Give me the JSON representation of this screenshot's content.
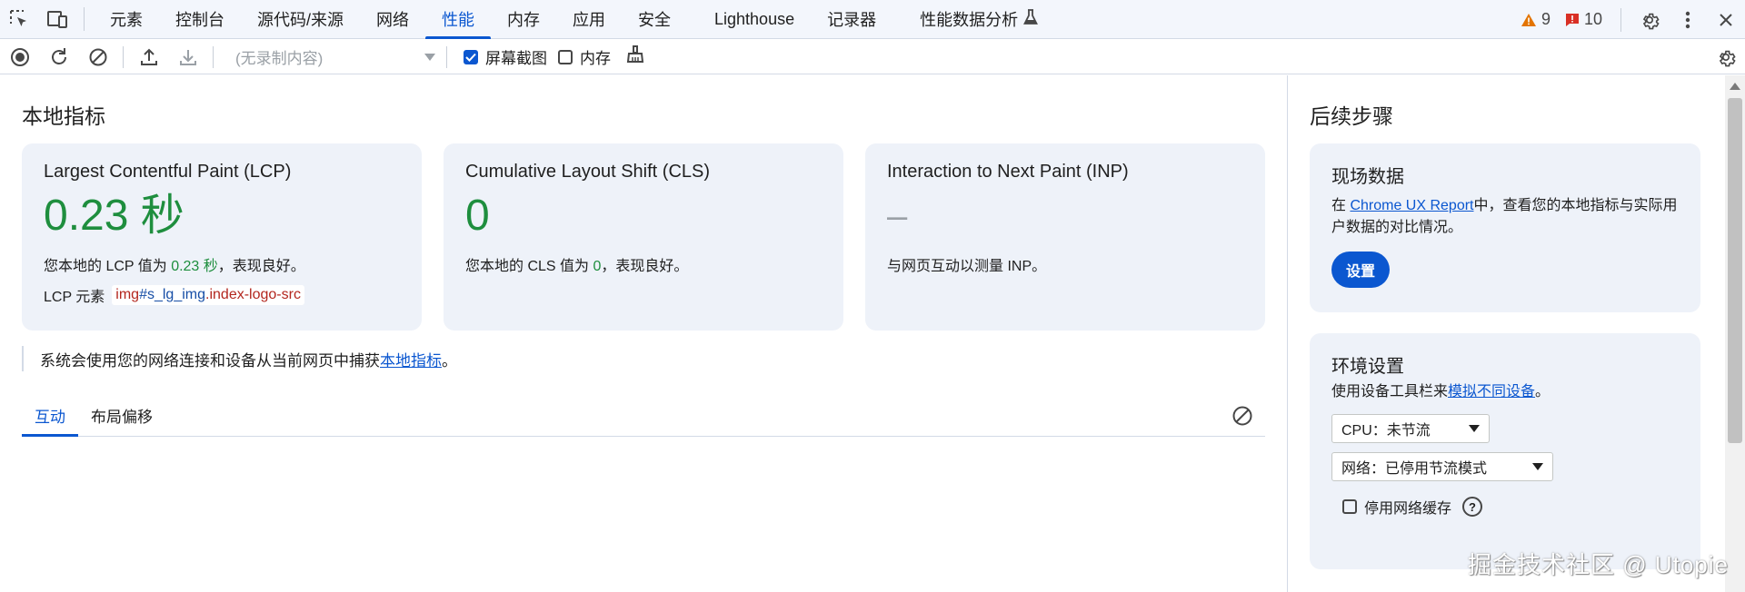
{
  "topbar": {
    "tabs": [
      {
        "label": "元素"
      },
      {
        "label": "控制台"
      },
      {
        "label": "源代码/来源"
      },
      {
        "label": "网络"
      },
      {
        "label": "性能"
      },
      {
        "label": "内存"
      },
      {
        "label": "应用"
      },
      {
        "label": "安全"
      },
      {
        "label": "Lighthouse"
      },
      {
        "label": "记录器"
      },
      {
        "label": "性能数据分析"
      }
    ],
    "active_tab": "性能",
    "warnings_count": "9",
    "issues_count": "10"
  },
  "toolbar": {
    "recording_placeholder": "(无录制内容)",
    "screenshots_label": "屏幕截图",
    "screenshots_checked": true,
    "memory_label": "内存",
    "memory_checked": false
  },
  "main": {
    "title": "本地指标",
    "cards": {
      "lcp": {
        "title": "Largest Contentful Paint (LCP)",
        "value": "0.23 秒",
        "desc_prefix": "您本地的 LCP 值为 ",
        "desc_value": "0.23 秒",
        "desc_suffix": "，表现良好。",
        "element_label": "LCP 元素",
        "element_tag": "img",
        "element_id": "#s_lg_img",
        "element_class": ".index-logo-src"
      },
      "cls": {
        "title": "Cumulative Layout Shift (CLS)",
        "value": "0",
        "desc_prefix": "您本地的 CLS 值为 ",
        "desc_value": "0",
        "desc_suffix": "，表现良好。"
      },
      "inp": {
        "title": "Interaction to Next Paint (INP)",
        "value": "–",
        "desc": "与网页互动以测量 INP。"
      }
    },
    "note_prefix": "系统会使用您的网络连接和设备从当前网页中捕获",
    "note_link": "本地指标",
    "note_suffix": "。",
    "subtabs": [
      {
        "label": "互动"
      },
      {
        "label": "布局偏移"
      }
    ]
  },
  "sidebar": {
    "title": "后续步骤",
    "field": {
      "title": "现场数据",
      "desc_prefix": "在 ",
      "desc_link": "Chrome UX Report",
      "desc_suffix": "中，查看您的本地指标与实际用户数据的对比情况。",
      "button": "设置"
    },
    "env": {
      "title": "环境设置",
      "desc_prefix": "使用设备工具栏来",
      "desc_link": "模拟不同设备",
      "desc_suffix": "。",
      "cpu": "CPU：未节流",
      "network": "网络：已停用节流模式",
      "cache_label": "停用网络缓存"
    }
  },
  "watermark": "掘金技术社区 @ Utopie",
  "colors": {
    "accent": "#0b57d0",
    "good": "#1e8e3e",
    "card_bg": "#eef2f9",
    "warning": "#e37400",
    "issue": "#d93025"
  }
}
